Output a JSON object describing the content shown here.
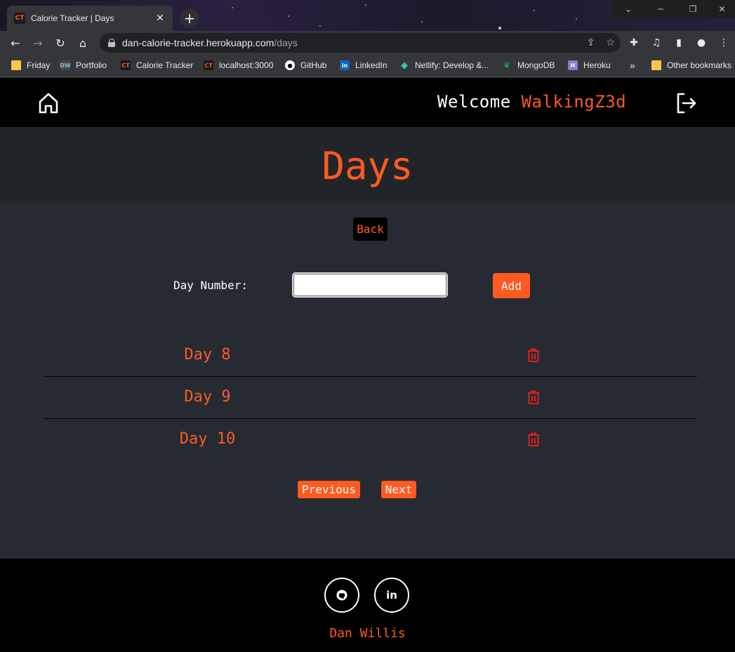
{
  "browser": {
    "tab_title": "Calorie Tracker | Days",
    "tab_favicon": "CT",
    "url_host": "dan-calorie-tracker.herokuapp.com",
    "url_path": "/days",
    "bookmarks": [
      {
        "label": "Friday",
        "icon": "folder-icon"
      },
      {
        "label": "Portfolio",
        "icon": "DW"
      },
      {
        "label": "Calorie Tracker",
        "icon": "CT"
      },
      {
        "label": "localhost:3000",
        "icon": "CT"
      },
      {
        "label": "GitHub",
        "icon": "github-icon"
      },
      {
        "label": "LinkedIn",
        "icon": "linkedin-icon"
      },
      {
        "label": "Netlify: Develop &...",
        "icon": "netlify-icon"
      },
      {
        "label": "MongoDB",
        "icon": "mongodb-icon"
      },
      {
        "label": "Heroku",
        "icon": "heroku-icon"
      }
    ],
    "bookmarks_overflow": "»",
    "other_bookmarks": "Other bookmarks"
  },
  "header": {
    "welcome_text": "Welcome",
    "username": "WalkingZ3d"
  },
  "page": {
    "title": "Days",
    "back_label": "Back",
    "day_number_label": "Day Number:",
    "day_number_value": "",
    "add_label": "Add",
    "days": [
      {
        "label": "Day 8"
      },
      {
        "label": "Day 9"
      },
      {
        "label": "Day 10"
      }
    ],
    "previous_label": "Previous",
    "next_label": "Next"
  },
  "footer": {
    "name": "Dan Willis"
  },
  "colors": {
    "accent": "#ff5a1f",
    "trash": "#e0201e",
    "background": "#262a33",
    "hero": "#212429",
    "navbar": "#000000"
  }
}
